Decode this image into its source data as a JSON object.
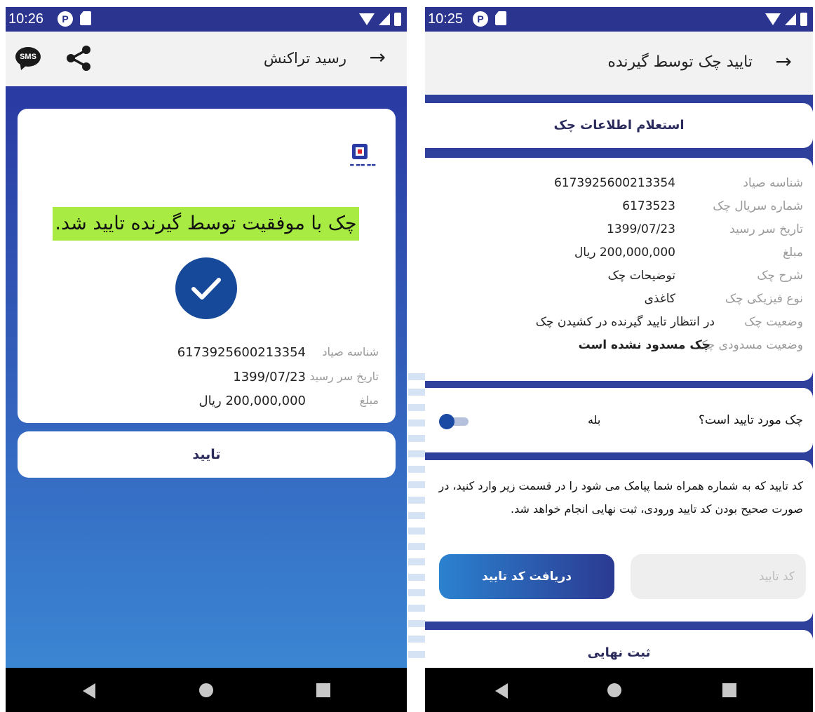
{
  "left": {
    "status": {
      "time": "10:26"
    },
    "appbar": {
      "title": "رسید تراکنش",
      "back_glyph": "→",
      "sms_label": "SMS"
    },
    "icons": {
      "sms": "sms-icon",
      "share": "share-icon",
      "back": "back-arrow-icon",
      "bank_logo": "bank-logo-icon",
      "check": "checkmark-circle-icon"
    },
    "receipt": {
      "success_message": "چک با موفقیت توسط گیرنده تایید شد.",
      "rows": [
        {
          "label": "شناسه صیاد",
          "value": "6173925600213354"
        },
        {
          "label": "تاریخ سر رسید",
          "value": "1399/07/23"
        },
        {
          "label": "مبلغ",
          "value": "200,000,000 ریال"
        }
      ]
    },
    "confirm_button": "تایید"
  },
  "right": {
    "status": {
      "time": "10:25"
    },
    "appbar": {
      "title": "تایید چک توسط گیرنده",
      "back_glyph": "→"
    },
    "inquiry_button": "استعلام اطلاعات چک",
    "details": [
      {
        "label": "شناسه صیاد",
        "value": "6173925600213354"
      },
      {
        "label": "شماره سریال چک",
        "value": "6173523"
      },
      {
        "label": "تاریخ سر رسید",
        "value": "1399/07/23"
      },
      {
        "label": "مبلغ",
        "value": "200,000,000 ریال"
      },
      {
        "label": "شرح چک",
        "value": "توضیحات چک"
      },
      {
        "label": "نوع فیزیکی چک",
        "value": "کاغذی"
      },
      {
        "label": "وضعیت چک",
        "value": "در انتظار تایید گیرنده در کشیدن چک"
      },
      {
        "label": "وضعیت مسدودی چک",
        "value": "چک مسدود نشده است"
      }
    ],
    "approval": {
      "question": "چک مورد تایید است؟",
      "answer": "بله",
      "toggle_on": false
    },
    "code": {
      "instruction": "کد تایید که به شماره همراه شما پیامک می شود را در قسمت زیر وارد کنید، در صورت صحیح بودن کد تایید ورودی، ثبت نهایی انجام خواهد شد.",
      "input_placeholder": "کد تایید",
      "get_code_button": "دریافت کد تایید"
    },
    "final_submit": "ثبت نهایی"
  },
  "colors": {
    "status_bar": "#2b3590",
    "gradient_top": "#2a3aa3",
    "gradient_bottom": "#3b86d3",
    "highlight": "#a8ec43",
    "check_circle": "#16499a",
    "toggle_thumb": "#1b4aa5"
  }
}
